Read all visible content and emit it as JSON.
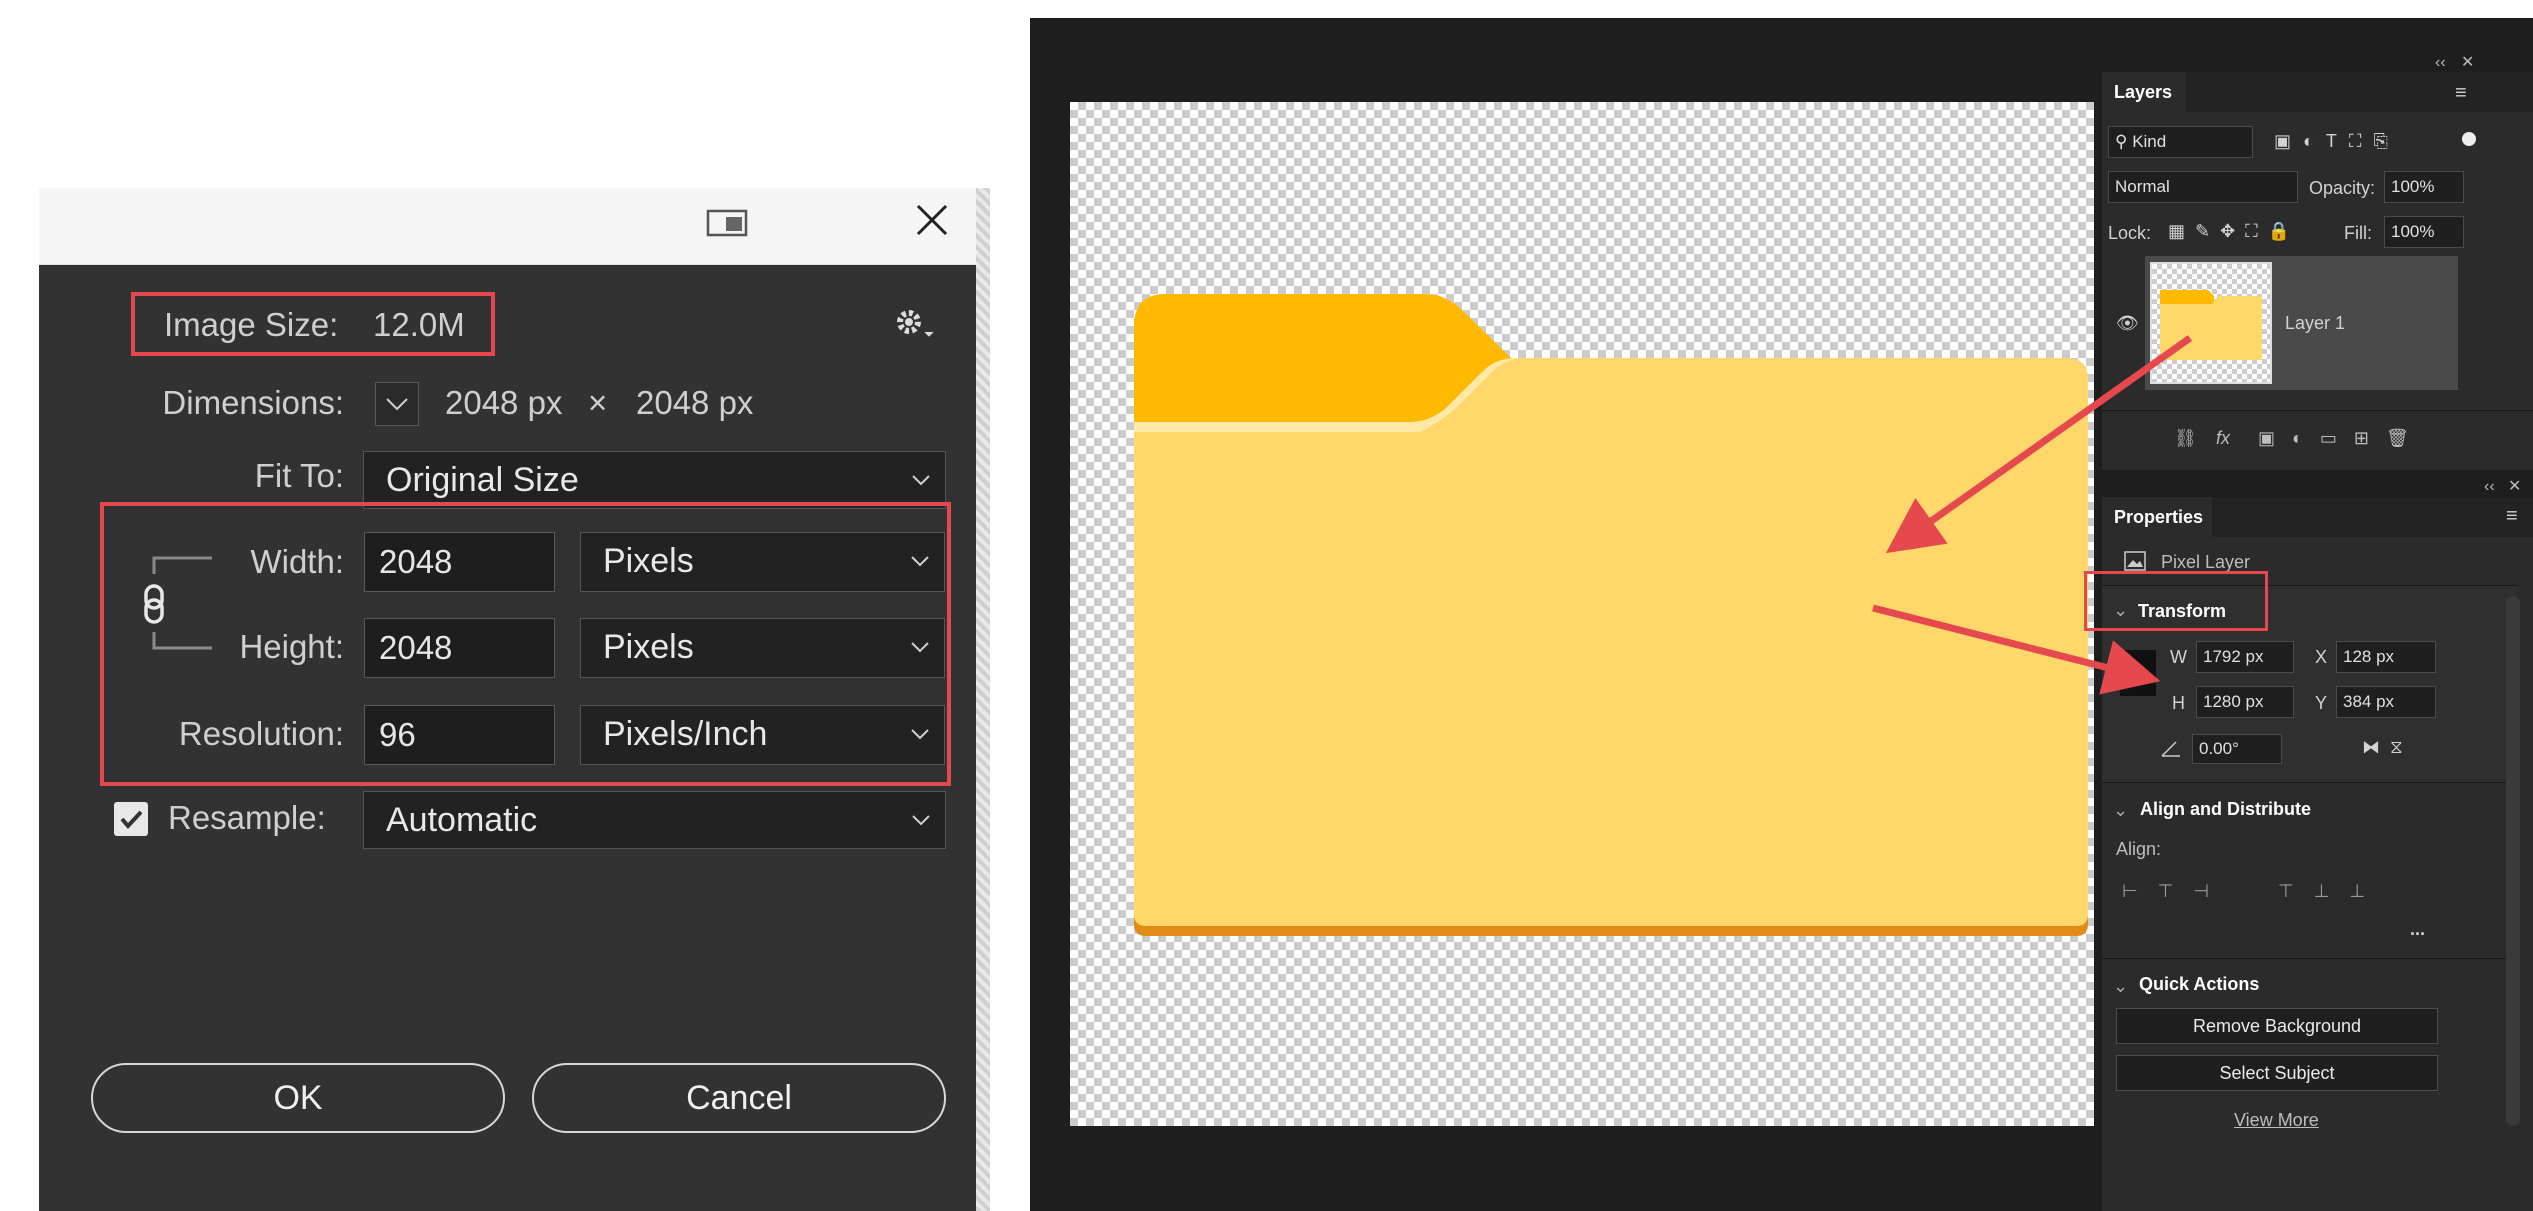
{
  "dialog": {
    "image_size_label": "Image Size:",
    "image_size_value": "12.0M",
    "dimensions_label": "Dimensions:",
    "dim_width": "2048 px",
    "dim_x": "×",
    "dim_height": "2048 px",
    "fit_to_label": "Fit To:",
    "fit_to_value": "Original Size",
    "width_label": "Width:",
    "width_value": "2048",
    "width_unit": "Pixels",
    "height_label": "Height:",
    "height_value": "2048",
    "height_unit": "Pixels",
    "resolution_label": "Resolution:",
    "resolution_value": "96",
    "resolution_unit": "Pixels/Inch",
    "resample_label": "Resample:",
    "resample_value": "Automatic",
    "resample_checked": true,
    "ok_label": "OK",
    "cancel_label": "Cancel"
  },
  "layers_panel": {
    "tab": "Layers",
    "filter_kind": "Kind",
    "blend_mode": "Normal",
    "opacity_label": "Opacity:",
    "opacity_value": "100%",
    "lock_label": "Lock:",
    "fill_label": "Fill:",
    "fill_value": "100%",
    "layer_name": "Layer 1",
    "fx_label": "fx"
  },
  "properties_panel": {
    "tab": "Properties",
    "kind": "Pixel Layer",
    "transform_title": "Transform",
    "w_label": "W",
    "w_value": "1792 px",
    "x_label": "X",
    "x_value": "128 px",
    "h_label": "H",
    "h_value": "1280 px",
    "y_label": "Y",
    "y_value": "384 px",
    "angle_value": "0.00°",
    "align_title": "Align and Distribute",
    "align_label": "Align:",
    "more": "...",
    "quick_actions_title": "Quick Actions",
    "remove_bg": "Remove Background",
    "select_subject": "Select Subject",
    "view_more": "View More"
  },
  "colors": {
    "annotation_red": "#e5484d",
    "folder_tab": "#ffb900",
    "folder_body": "#ffd76a",
    "folder_shadow": "#e08c16"
  }
}
